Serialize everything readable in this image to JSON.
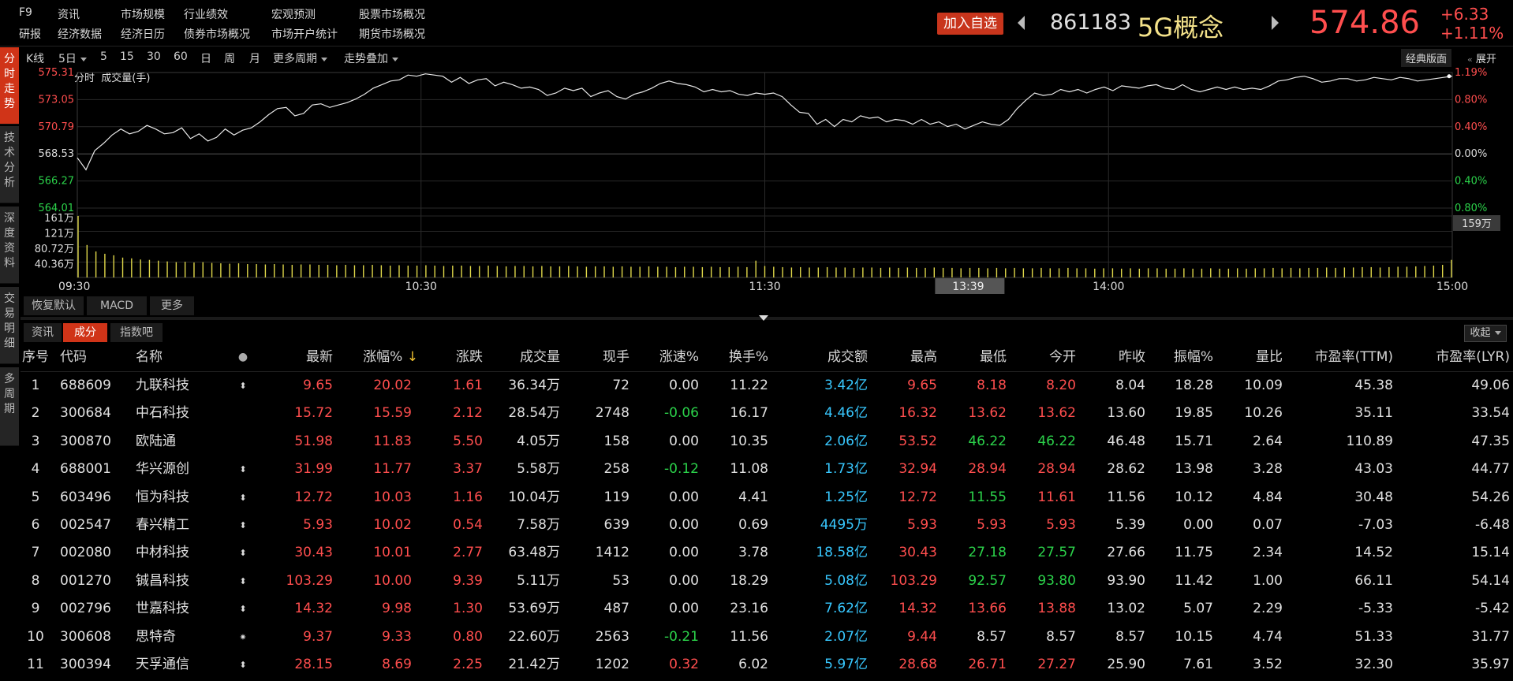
{
  "menu": {
    "row1": [
      "F9",
      "资讯",
      "市场规模",
      "行业绩效",
      "宏观预测",
      "股票市场概况"
    ],
    "row2": [
      "研报",
      "经济数据",
      "经济日历",
      "债券市场概况",
      "市场开户统计",
      "期货市场概况"
    ]
  },
  "header": {
    "add_fav": "加入自选",
    "code": "861183",
    "name": "5G概念",
    "price": "574.86",
    "change": "+6.33",
    "change_pct": "+1.11%"
  },
  "left_tabs": [
    {
      "label": "分时走势",
      "active": true
    },
    {
      "label": "技术分析",
      "active": false
    },
    {
      "label": "深度资料",
      "active": false
    },
    {
      "label": "交易明细",
      "active": false
    },
    {
      "label": "多周期",
      "active": false
    }
  ],
  "chart_toolbar": {
    "items": [
      "K线",
      "5日",
      "5",
      "15",
      "30",
      "60",
      "日",
      "周",
      "月",
      "更多周期",
      "走势叠加"
    ],
    "classic": "经典版面",
    "expand": "展开",
    "subtitle": "分时  成交量(手)"
  },
  "chart_data": {
    "type": "line",
    "price_ticks_left": [
      "575.31",
      "573.05",
      "570.79",
      "568.53",
      "566.27",
      "564.01"
    ],
    "pct_ticks_right": [
      "1.19%",
      "0.80%",
      "0.40%",
      "0.00%",
      "0.40%",
      "0.80%"
    ],
    "volume_ticks": [
      "161万",
      "121万",
      "80.72万",
      "40.36万"
    ],
    "volume_badge": "159万",
    "time_labels": [
      "09:30",
      "10:30",
      "11:30",
      "14:00",
      "15:00"
    ],
    "cursor_time": "13:39",
    "ylim": [
      564.01,
      575.31
    ],
    "series": [
      {
        "values": [
          568.2,
          567.2,
          568.8,
          569.4,
          570.1,
          570.6,
          570.2,
          570.4,
          570.9,
          570.6,
          570.2,
          570.3,
          570.7,
          569.8,
          570.2,
          569.6,
          569.9,
          570.6,
          570.1,
          570.5,
          570.7,
          571.2,
          571.8,
          572.3,
          572.4,
          571.7,
          571.9,
          572.6,
          572.7,
          572.4,
          572.6,
          572.8,
          573.1,
          573.5,
          574.0,
          574.3,
          574.6,
          574.7,
          575.1,
          575.0,
          575.2,
          575.1,
          575.0,
          574.5,
          574.9,
          574.4,
          574.7,
          574.8,
          574.2,
          574.5,
          574.3,
          574.0,
          574.1,
          573.9,
          573.4,
          573.6,
          574.0,
          573.8,
          574.0,
          573.3,
          573.6,
          573.8,
          573.3,
          573.1,
          573.5,
          573.7,
          574.0,
          574.4,
          574.6,
          574.4,
          574.3,
          574.1,
          573.7,
          573.9,
          573.7,
          573.8,
          573.5,
          573.4,
          573.6,
          573.5,
          573.6,
          573.3,
          572.6,
          572.0,
          571.9,
          571.0,
          571.4,
          570.8,
          571.4,
          571.2,
          571.7,
          571.5,
          571.6,
          571.2,
          571.4,
          571.3,
          571.0,
          571.4,
          571.0,
          571.2,
          570.8,
          571.0,
          570.6,
          570.9,
          571.2,
          571.0,
          570.9,
          571.4,
          572.3,
          573.0,
          573.6,
          573.4,
          573.5,
          573.9,
          573.7,
          573.9,
          573.6,
          573.9,
          574.1,
          573.8,
          574.2,
          574.1,
          574.0,
          574.2,
          574.3,
          574.0,
          573.9,
          574.3,
          573.9,
          573.7,
          573.9,
          574.1,
          573.9,
          574.1,
          573.9,
          574.0,
          573.9,
          574.2,
          574.6,
          574.7,
          574.9,
          575.0,
          574.8,
          574.5,
          574.6,
          574.8,
          574.8,
          574.6,
          574.7,
          574.9,
          574.8,
          574.7,
          574.9,
          574.8,
          574.6,
          574.7,
          574.8,
          574.9,
          575.0
        ]
      }
    ],
    "volume": [
      161,
      85,
      68,
      62,
      58,
      52,
      50,
      47,
      46,
      44,
      42,
      40,
      41,
      39,
      40,
      38,
      37,
      36,
      37,
      35,
      35,
      34,
      35,
      34,
      33,
      34,
      34,
      33,
      33,
      32,
      33,
      32,
      32,
      33,
      32,
      31,
      32,
      31,
      31,
      32,
      31,
      30,
      31,
      31,
      30,
      30,
      31,
      30,
      29,
      30,
      30,
      29,
      30,
      29,
      29,
      30,
      29,
      28,
      29,
      29,
      28,
      29,
      28,
      28,
      29,
      28,
      28,
      27,
      28,
      28,
      27,
      28,
      27,
      27,
      28,
      27,
      44,
      30,
      28,
      27,
      26,
      27,
      26,
      26,
      27,
      26,
      26,
      25,
      26,
      26,
      25,
      26,
      25,
      26,
      25,
      25,
      26,
      25,
      25,
      24,
      25,
      25,
      24,
      25,
      24,
      25,
      24,
      24,
      25,
      24,
      24,
      25,
      24,
      24,
      23,
      24,
      24,
      23,
      24,
      23,
      24,
      24,
      23,
      23,
      24,
      23,
      23,
      24,
      23,
      23,
      24,
      23,
      24,
      24,
      25,
      24,
      25,
      24,
      25,
      25,
      26,
      25,
      26,
      26,
      27,
      27,
      26,
      27,
      28,
      28,
      29,
      30,
      31,
      33,
      46
    ]
  },
  "chart_buttons": [
    "恢复默认",
    "MACD",
    "更多"
  ],
  "data_tabs": [
    "资讯",
    "成分",
    "指数吧"
  ],
  "sort_select": "收起",
  "table": {
    "headers": [
      "序号",
      "代码",
      "名称",
      "●",
      "最新",
      "涨幅%",
      "涨跌",
      "成交量",
      "现手",
      "涨速%",
      "换手%",
      "成交额",
      "最高",
      "最低",
      "今开",
      "昨收",
      "振幅%",
      "量比",
      "市盈率(TTM)",
      "市盈率(LYR)"
    ],
    "sort_arrow": "↓",
    "rows": [
      {
        "no": "1",
        "code": "688609",
        "name": "九联科技",
        "mark": "⬍",
        "last": "9.65",
        "pct": "20.02",
        "chg": "1.61",
        "vol": "36.34万",
        "hand": "72",
        "speed": "0.00",
        "turn": "11.22",
        "amt": "3.42亿",
        "high": "9.65",
        "low": "8.18",
        "open": "8.20",
        "prev": "8.04",
        "amp": "18.28",
        "ratio": "10.09",
        "pe_ttm": "45.38",
        "pe_lyr": "49.06"
      },
      {
        "no": "2",
        "code": "300684",
        "name": "中石科技",
        "mark": "",
        "last": "15.72",
        "pct": "15.59",
        "chg": "2.12",
        "vol": "28.54万",
        "hand": "2748",
        "speed": "-0.06",
        "turn": "16.17",
        "amt": "4.46亿",
        "high": "16.32",
        "low": "13.62",
        "open": "13.62",
        "prev": "13.60",
        "amp": "19.85",
        "ratio": "10.26",
        "pe_ttm": "35.11",
        "pe_lyr": "33.54"
      },
      {
        "no": "3",
        "code": "300870",
        "name": "欧陆通",
        "mark": "",
        "last": "51.98",
        "pct": "11.83",
        "chg": "5.50",
        "vol": "4.05万",
        "hand": "158",
        "speed": "0.00",
        "turn": "10.35",
        "amt": "2.06亿",
        "high": "53.52",
        "low": "46.22",
        "open": "46.22",
        "prev": "46.48",
        "amp": "15.71",
        "ratio": "2.64",
        "pe_ttm": "110.89",
        "pe_lyr": "47.35"
      },
      {
        "no": "4",
        "code": "688001",
        "name": "华兴源创",
        "mark": "⬍",
        "last": "31.99",
        "pct": "11.77",
        "chg": "3.37",
        "vol": "5.58万",
        "hand": "258",
        "speed": "-0.12",
        "turn": "11.08",
        "amt": "1.73亿",
        "high": "32.94",
        "low": "28.94",
        "open": "28.94",
        "prev": "28.62",
        "amp": "13.98",
        "ratio": "3.28",
        "pe_ttm": "43.03",
        "pe_lyr": "44.77"
      },
      {
        "no": "5",
        "code": "603496",
        "name": "恒为科技",
        "mark": "⬍",
        "last": "12.72",
        "pct": "10.03",
        "chg": "1.16",
        "vol": "10.04万",
        "hand": "119",
        "speed": "0.00",
        "turn": "4.41",
        "amt": "1.25亿",
        "high": "12.72",
        "low": "11.55",
        "open": "11.61",
        "prev": "11.56",
        "amp": "10.12",
        "ratio": "4.84",
        "pe_ttm": "30.48",
        "pe_lyr": "54.26"
      },
      {
        "no": "6",
        "code": "002547",
        "name": "春兴精工",
        "mark": "⬍",
        "last": "5.93",
        "pct": "10.02",
        "chg": "0.54",
        "vol": "7.58万",
        "hand": "639",
        "speed": "0.00",
        "turn": "0.69",
        "amt": "4495万",
        "high": "5.93",
        "low": "5.93",
        "open": "5.93",
        "prev": "5.39",
        "amp": "0.00",
        "ratio": "0.07",
        "pe_ttm": "-7.03",
        "pe_lyr": "-6.48"
      },
      {
        "no": "7",
        "code": "002080",
        "name": "中材科技",
        "mark": "⬍",
        "last": "30.43",
        "pct": "10.01",
        "chg": "2.77",
        "vol": "63.48万",
        "hand": "1412",
        "speed": "0.00",
        "turn": "3.78",
        "amt": "18.58亿",
        "high": "30.43",
        "low": "27.18",
        "open": "27.57",
        "prev": "27.66",
        "amp": "11.75",
        "ratio": "2.34",
        "pe_ttm": "14.52",
        "pe_lyr": "15.14"
      },
      {
        "no": "8",
        "code": "001270",
        "name": "铖昌科技",
        "mark": "⬍",
        "last": "103.29",
        "pct": "10.00",
        "chg": "9.39",
        "vol": "5.11万",
        "hand": "53",
        "speed": "0.00",
        "turn": "18.29",
        "amt": "5.08亿",
        "high": "103.29",
        "low": "92.57",
        "open": "93.80",
        "prev": "93.90",
        "amp": "11.42",
        "ratio": "1.00",
        "pe_ttm": "66.11",
        "pe_lyr": "54.14"
      },
      {
        "no": "9",
        "code": "002796",
        "name": "世嘉科技",
        "mark": "⬍",
        "last": "14.32",
        "pct": "9.98",
        "chg": "1.30",
        "vol": "53.69万",
        "hand": "487",
        "speed": "0.00",
        "turn": "23.16",
        "amt": "7.62亿",
        "high": "14.32",
        "low": "13.66",
        "open": "13.88",
        "prev": "13.02",
        "amp": "5.07",
        "ratio": "2.29",
        "pe_ttm": "-5.33",
        "pe_lyr": "-5.42"
      },
      {
        "no": "10",
        "code": "300608",
        "name": "思特奇",
        "mark": "✷",
        "last": "9.37",
        "pct": "9.33",
        "chg": "0.80",
        "vol": "22.60万",
        "hand": "2563",
        "speed": "-0.21",
        "turn": "11.56",
        "amt": "2.07亿",
        "high": "9.44",
        "low": "8.57",
        "open": "8.57",
        "prev": "8.57",
        "amp": "10.15",
        "ratio": "4.74",
        "pe_ttm": "51.33",
        "pe_lyr": "31.77"
      },
      {
        "no": "11",
        "code": "300394",
        "name": "天孚通信",
        "mark": "⬍",
        "last": "28.15",
        "pct": "8.69",
        "chg": "2.25",
        "vol": "21.42万",
        "hand": "1202",
        "speed": "0.32",
        "turn": "6.02",
        "amt": "5.97亿",
        "high": "28.68",
        "low": "26.71",
        "open": "27.27",
        "prev": "25.90",
        "amp": "7.61",
        "ratio": "3.52",
        "pe_ttm": "32.30",
        "pe_lyr": "35.97"
      }
    ]
  }
}
